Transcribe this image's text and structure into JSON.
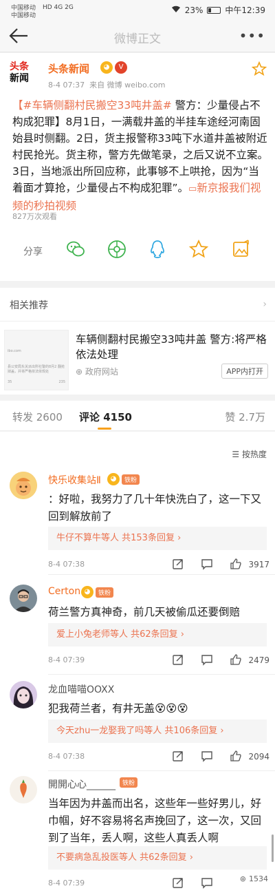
{
  "status_bar": {
    "carrier_1": "中国移动",
    "carrier_2": "中国移动",
    "signal": "HD 4G 2G",
    "battery": "23%",
    "time": "中午12:39"
  },
  "nav": {
    "title": "微博正文",
    "more": "•••"
  },
  "post": {
    "logo_line1": "头条",
    "logo_line2": "新闻",
    "author": "头条新闻",
    "time": "8-4 07:37",
    "source": "来自 微博 weibo.com",
    "hashtag": "【#车辆侧翻村民搬空33吨井盖#",
    "body": " 警方：少量侵占不构成犯罪】8月1日，一满载井盖的半挂车途经河南固始县时侧翻。2日，货主报警称33吨下水道井盖被附近村民抢光。货主称，警方先做笔录，之后又说不立案。3日，当地派出所回应称，此事够不上哄抢，因为“当着面才算抢，少量侵占不构成犯罪”。",
    "video_link": "新京报我们视频的秒拍视频",
    "views": "827万次观看",
    "share_label": "分享"
  },
  "related": {
    "header": "相关推荐",
    "thumb_url": "ibo.com",
    "thumb_text": "县公安局东关派出所社警的8月2 翻抢掉盖，并将严格依法依规处",
    "thumb_count_1": "35",
    "thumb_count_2": "235",
    "title": "车辆侧翻村民搬空33吨井盖 警方:将严格依法处理",
    "source": "政府网站",
    "app_button": "APP内打开"
  },
  "tabs": {
    "repost": "转发 2600",
    "comments": "评论 4150",
    "likes": "赞 2.7万"
  },
  "sort_label": "按热度",
  "comments": [
    {
      "name": "快乐收集站Ⅱ",
      "fan_badge": "铁粉",
      "text": "：好啦，我努力了几十年快洗白了，这一下又回到解放前了",
      "replies": "牛仔不算牛等人  共153条回复 ›",
      "time": "8-4 07:38",
      "likes": "3917"
    },
    {
      "name": "Certon",
      "fan_badge": "铁粉",
      "text": "荷兰警方真神奇，前几天被偷瓜还要倒赔",
      "replies": "爱上小兔老师等人  共62条回复 ›",
      "time": "8-4 07:39",
      "likes": "2479"
    },
    {
      "name": "龙血喵喵OOXX",
      "text": "犯我荷兰者，有井无盖😵😵😵",
      "replies": "今天zhu一龙娶我了吗等人  共106条回复 ›",
      "time": "8-4 07:38",
      "likes": "2094"
    },
    {
      "name": "開開心心______",
      "fan_badge": "铁粉",
      "text": "当年因为井盖而出名，这些年一些好男儿，好巾帼，好不容易将名声挽回了，这一次，又回到了当年，丢人啊，这些人真丢人啊",
      "replies": "不要病急乱投医等人  共62条回复 ›",
      "time": "8-4 07:39"
    }
  ],
  "watermark": "1534",
  "colors": {
    "accent": "#eb7350",
    "name_orange": "#f26d22",
    "tab_underline": "#f8a11d"
  }
}
